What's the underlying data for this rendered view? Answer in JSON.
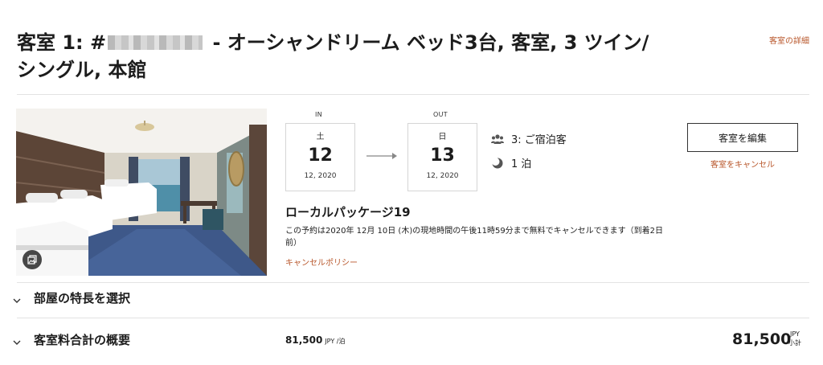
{
  "header": {
    "title_prefix": "客室 1: #",
    "title_rest": " - オーシャンドリーム ベッド3台, 客室, 3 ツイン/シングル, 本館",
    "room_details_link": "客室の詳細"
  },
  "stay": {
    "checkin": {
      "label": "IN",
      "weekday": "土",
      "day": "12",
      "year_month": "12, 2020"
    },
    "checkout": {
      "label": "OUT",
      "weekday": "日",
      "day": "13",
      "year_month": "12, 2020"
    },
    "guests": "3: ご宿泊客",
    "nights": "1 泊"
  },
  "actions": {
    "edit_room": "客室を編集",
    "cancel_room": "客室をキャンセル"
  },
  "package": {
    "name": "ローカルパッケージ19",
    "cancel_note": "この予約は2020年 12月 10日 (木)の現地時間の午後11時59分まで無料でキャンセルできます（到着2日前）",
    "policy_link": "キャンセルポリシー"
  },
  "sections": {
    "room_features": "部屋の特長を選択",
    "rate_summary": "客室料合計の概要"
  },
  "pricing": {
    "nightly_amount": "81,500",
    "nightly_unit": "JPY /泊",
    "total_amount": "81,500",
    "total_currency": "JPY",
    "total_label": "小計"
  },
  "colors": {
    "accent": "#b8562a",
    "text": "#1c1c1c",
    "divider": "#e3e3e3"
  },
  "icons": {
    "guests": "guests-icon",
    "nights": "moon-icon",
    "arrow": "arrow-right-icon",
    "photo": "photo-gallery-icon",
    "expand": "chevron-down-icon"
  }
}
